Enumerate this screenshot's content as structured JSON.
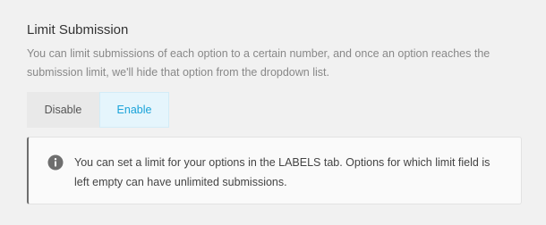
{
  "limit_submission": {
    "title": "Limit Submission",
    "description": "You can limit submissions of each option to a certain number, and once an option reaches the submission limit, we'll hide that option from the dropdown list.",
    "options": {
      "disable_label": "Disable",
      "enable_label": "Enable",
      "selected": "Enable"
    },
    "notice": {
      "icon": "info-icon",
      "text": "You can set a limit for your options in the LABELS tab. Options for which limit field is left empty can have unlimited submissions."
    }
  },
  "colors": {
    "accent": "#1aa3d9",
    "selected_bg": "#e5f5fc",
    "page_bg": "#f1f1f1"
  }
}
